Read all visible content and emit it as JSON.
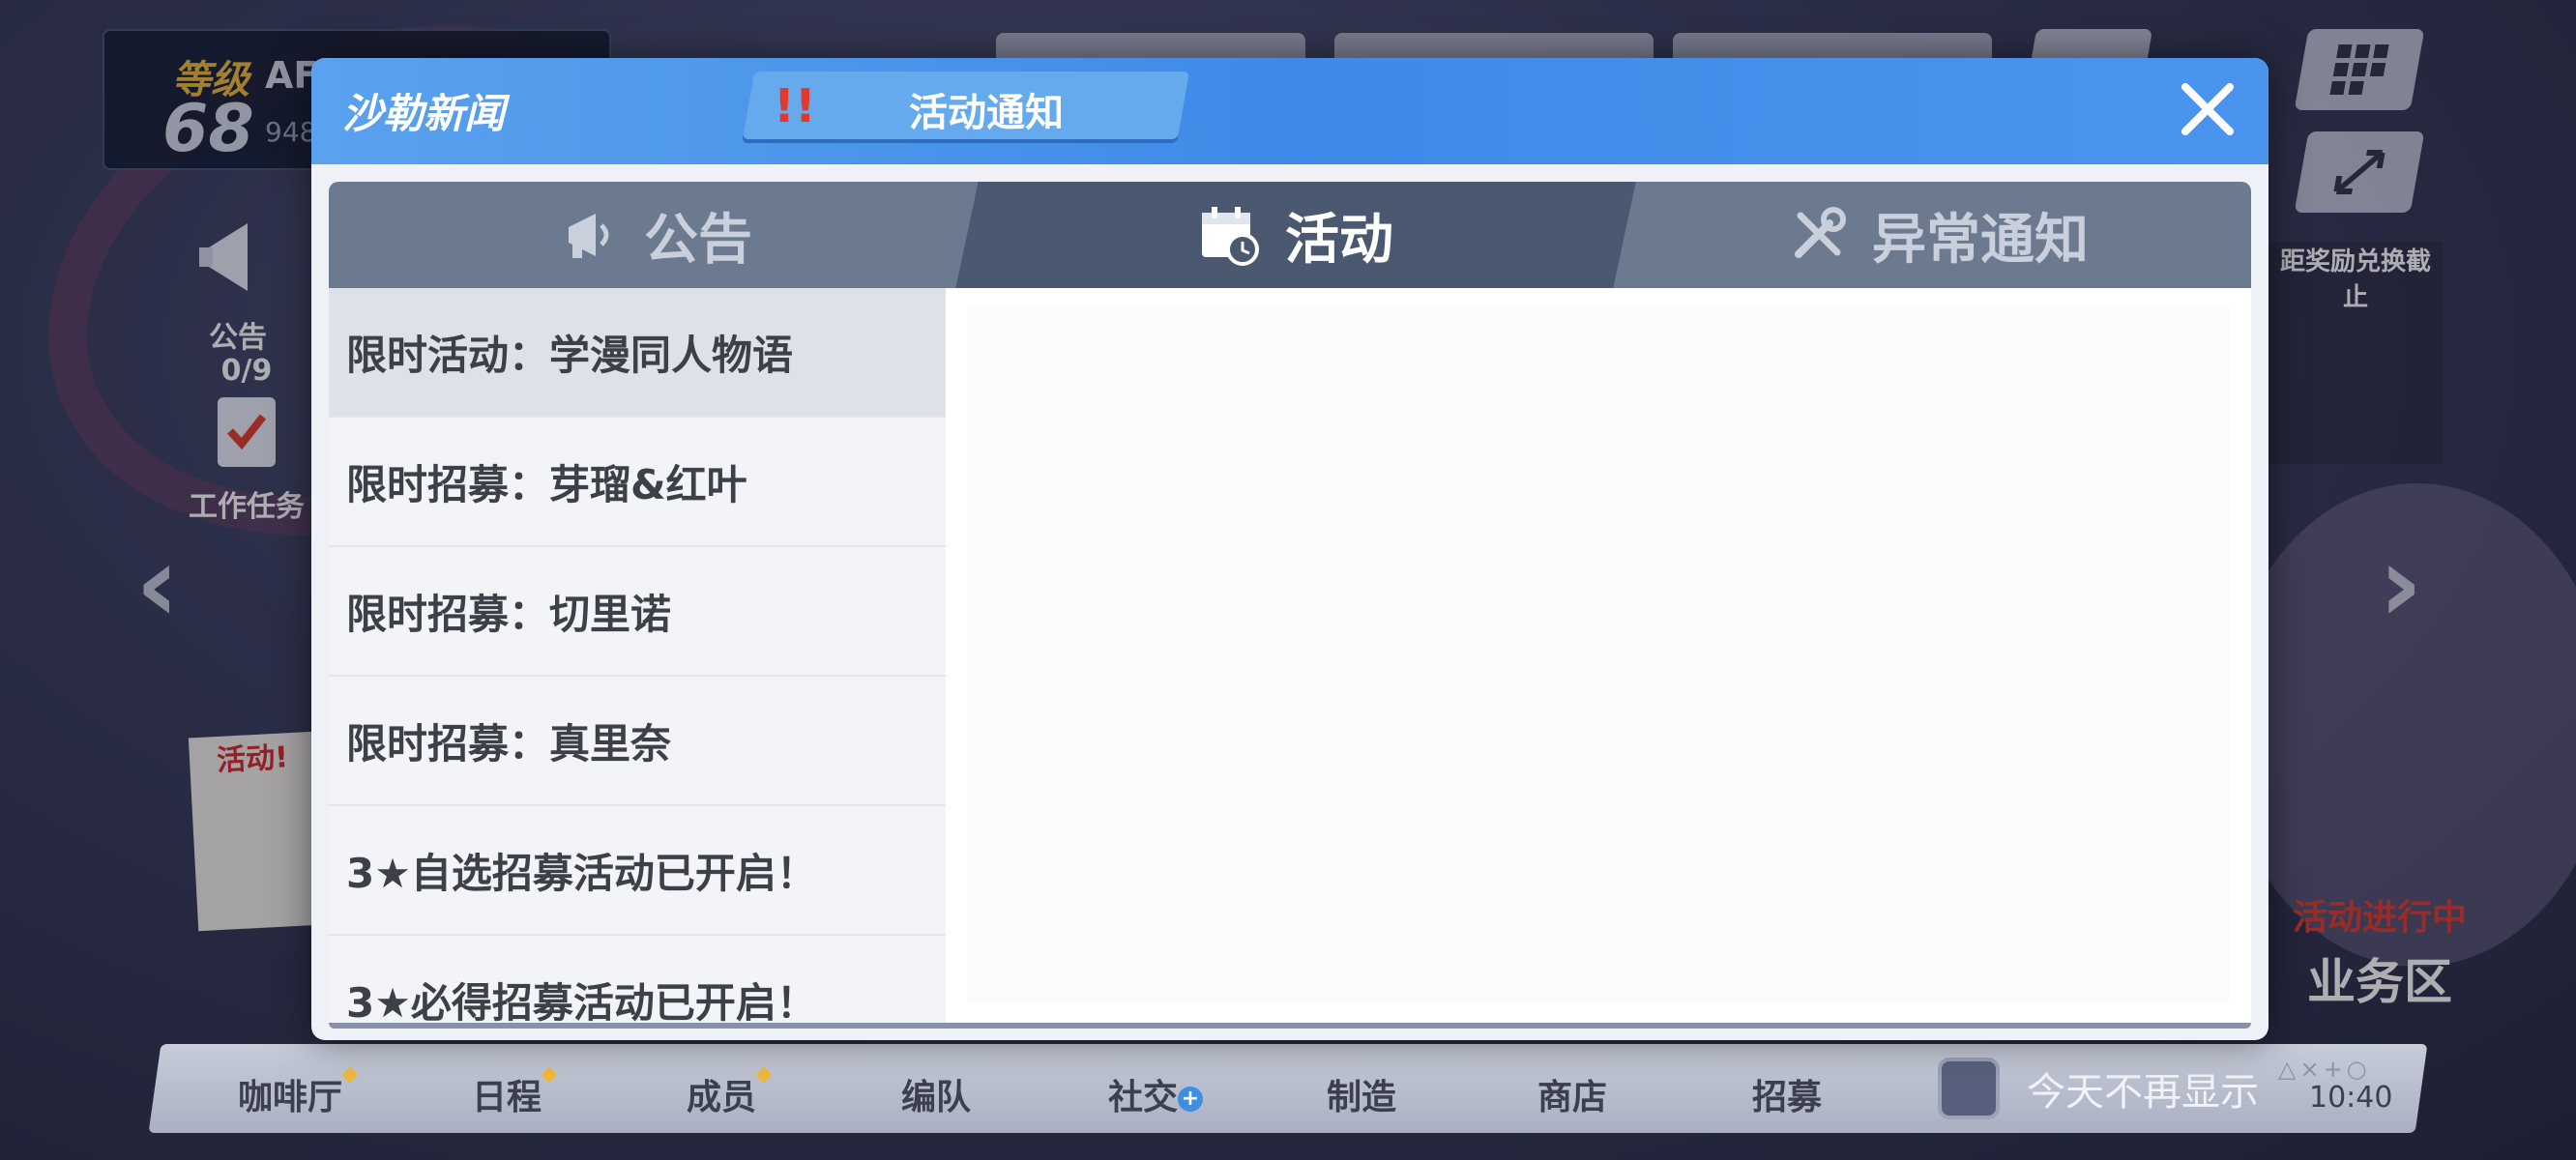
{
  "hud": {
    "level_label": "等级",
    "level": "68",
    "name_partial": "AF",
    "sub_partial": "948"
  },
  "side_tiles": {
    "announcement": "公告",
    "work_counter": "0/9",
    "work_tasks": "工作任务",
    "reward_note": "距奖励兑换截止",
    "event_banner": "活动!",
    "event_running": "活动进行中",
    "business_area": "业务区"
  },
  "modal": {
    "title": "沙勒新闻",
    "notice_tab_label": "活动通知",
    "close_label": "关闭"
  },
  "tabs": [
    {
      "label": "公告",
      "icon": "megaphone-icon",
      "active": false
    },
    {
      "label": "活动",
      "icon": "calendar-clock-icon",
      "active": true
    },
    {
      "label": "异常通知",
      "icon": "tools-icon",
      "active": false
    }
  ],
  "events": [
    "限时活动：学漫同人物语",
    "限时招募：芽瑠&红叶",
    "限时招募：切里诺",
    "限时招募：真里奈",
    "3★自选招募活动已开启！",
    "3★必得招募活动已开启！"
  ],
  "bottom_nav": [
    {
      "label": "咖啡厅",
      "dot": true
    },
    {
      "label": "日程",
      "dot": true
    },
    {
      "label": "成员",
      "dot": true
    },
    {
      "label": "编队",
      "dot": false
    },
    {
      "label": "社交",
      "plus": true
    },
    {
      "label": "制造",
      "dot": false
    },
    {
      "label": "商店",
      "dot": false
    },
    {
      "label": "招募",
      "dot": false
    }
  ],
  "dont_show_today": "今天不再显示",
  "clock": "10:40",
  "ps_buttons": "△×+○",
  "colors": {
    "header_blue": "#3f8ae8",
    "tab_active": "#4a5870",
    "tab_inactive": "#6c7a8f",
    "alert_red": "#e23a2a",
    "accent_gold": "#f0b83a"
  }
}
